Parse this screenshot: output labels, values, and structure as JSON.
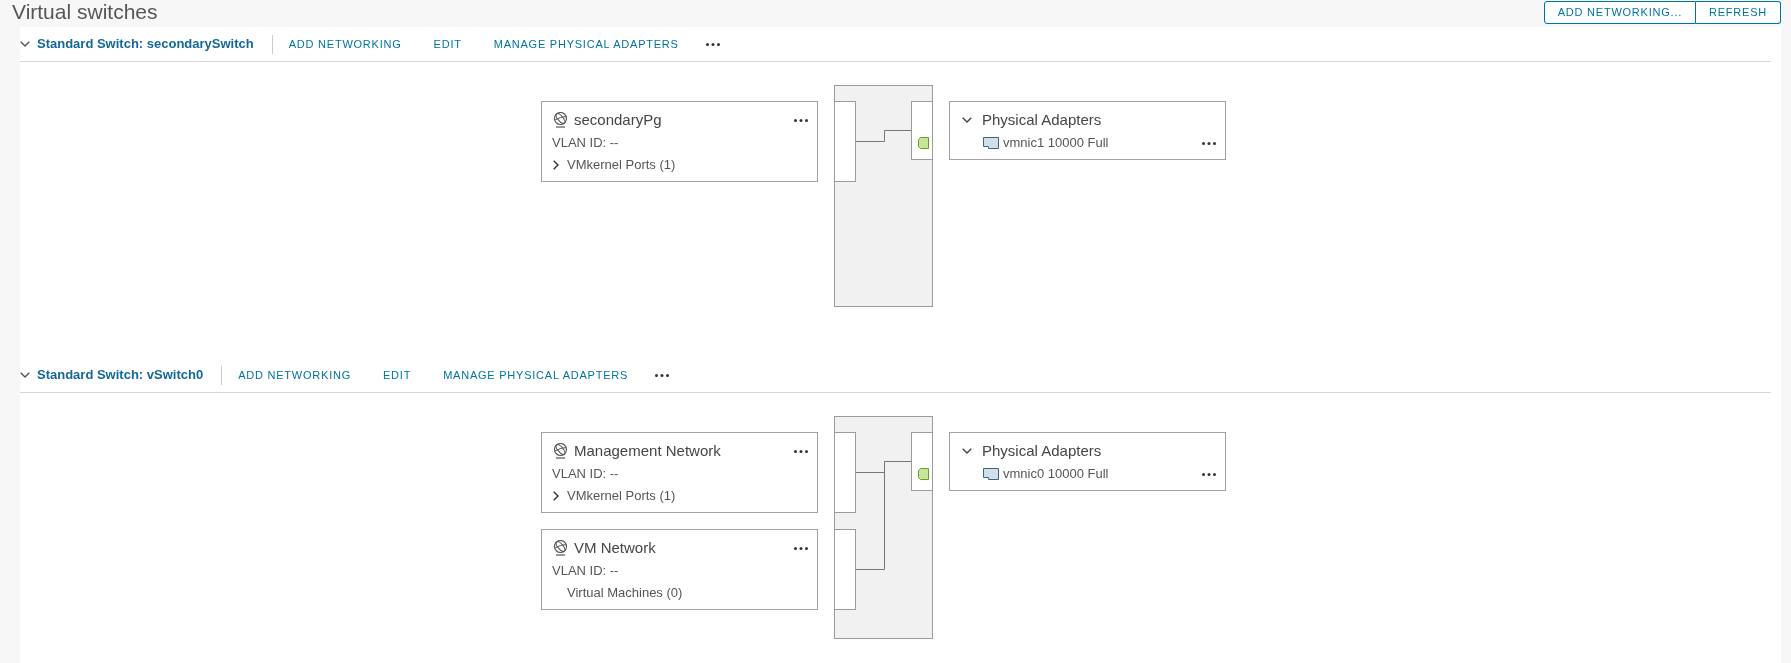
{
  "page": {
    "title": "Virtual switches",
    "buttons": [
      "ADD NETWORKING...",
      "REFRESH"
    ]
  },
  "switches": [
    {
      "title": "Standard Switch: secondarySwitch",
      "expanded": true,
      "actions": [
        "ADD NETWORKING",
        "EDIT",
        "MANAGE PHYSICAL ADAPTERS"
      ],
      "port_groups": [
        {
          "name": "secondaryPg",
          "vlan": "VLAN ID: --",
          "members": {
            "label": "VMkernel Ports (1)",
            "expanded": false
          }
        }
      ],
      "physical_adapters": {
        "title": "Physical Adapters",
        "expanded": true,
        "adapters": [
          {
            "name": "vmnic1 10000 Full"
          }
        ]
      }
    },
    {
      "title": "Standard Switch: vSwitch0",
      "expanded": true,
      "actions": [
        "ADD NETWORKING",
        "EDIT",
        "MANAGE PHYSICAL ADAPTERS"
      ],
      "port_groups": [
        {
          "name": "Management Network",
          "vlan": "VLAN ID: --",
          "members": {
            "label": "VMkernel Ports (1)",
            "expanded": false
          }
        },
        {
          "name": "VM Network",
          "vlan": "VLAN ID: --",
          "members": {
            "label": "Virtual Machines (0)"
          }
        }
      ],
      "physical_adapters": {
        "title": "Physical Adapters",
        "expanded": true,
        "adapters": [
          {
            "name": "vmnic0 10000 Full"
          }
        ]
      }
    }
  ]
}
